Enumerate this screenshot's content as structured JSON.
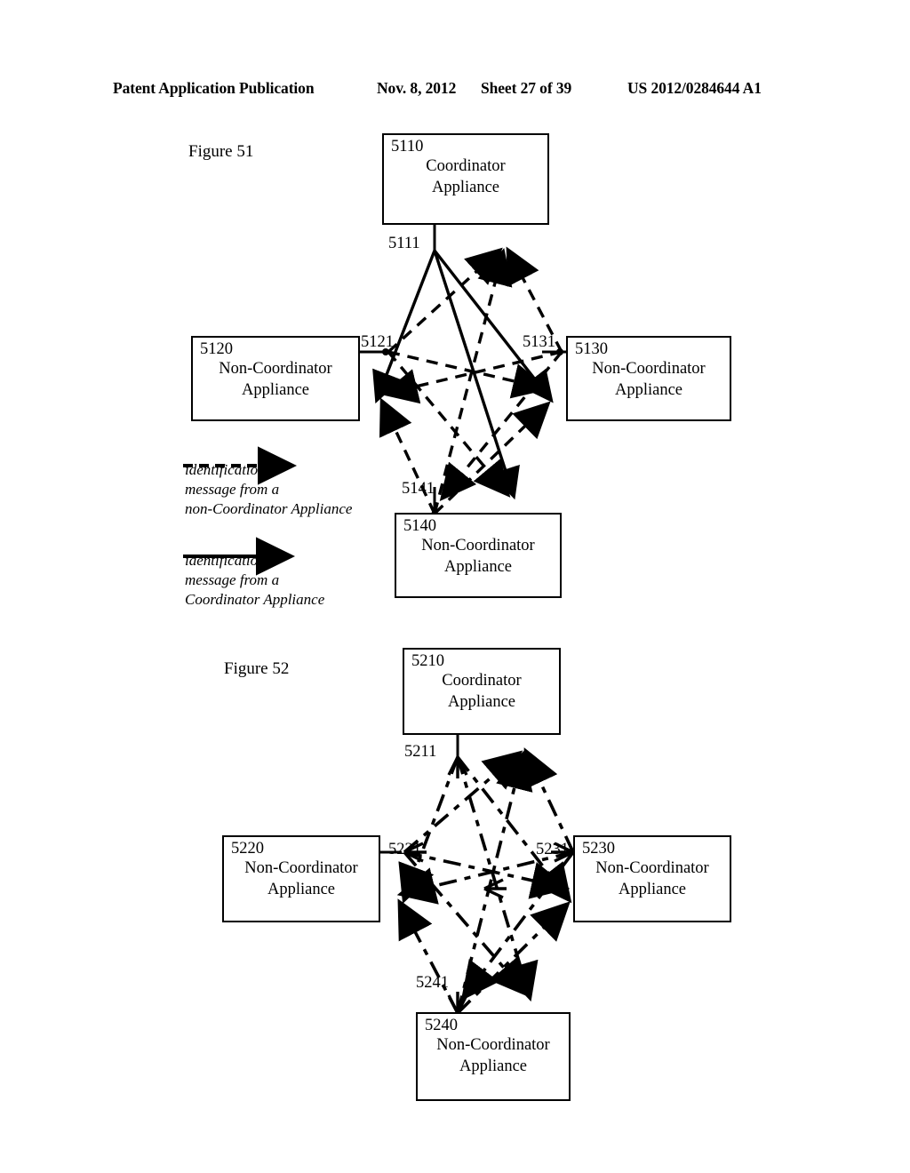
{
  "header": {
    "publication": "Patent Application Publication",
    "date": "Nov. 8, 2012",
    "sheet": "Sheet 27 of 39",
    "number": "US 2012/0284644 A1"
  },
  "figure51": {
    "caption": "Figure 51",
    "boxes": [
      {
        "id": "5110",
        "title_line1": "Coordinator",
        "title_line2": "Appliance"
      },
      {
        "id": "5120",
        "title_line1": "Non-Coordinator",
        "title_line2": "Appliance"
      },
      {
        "id": "5130",
        "title_line1": "Non-Coordinator",
        "title_line2": "Appliance"
      },
      {
        "id": "5140",
        "title_line1": "Non-Coordinator",
        "title_line2": "Appliance"
      }
    ],
    "nodes": [
      {
        "id": "5111"
      },
      {
        "id": "5121"
      },
      {
        "id": "5131"
      },
      {
        "id": "5141"
      }
    ],
    "legend": [
      {
        "line1": "identification",
        "line2": "message from a",
        "line3": "non-Coordinator Appliance",
        "style": "dashed"
      },
      {
        "line1": "identification",
        "line2": "message from a",
        "line3": "Coordinator Appliance",
        "style": "solid"
      }
    ]
  },
  "figure52": {
    "caption": "Figure 52",
    "boxes": [
      {
        "id": "5210",
        "title_line1": "Coordinator",
        "title_line2": "Appliance"
      },
      {
        "id": "5220",
        "title_line1": "Non-Coordinator",
        "title_line2": "Appliance"
      },
      {
        "id": "5230",
        "title_line1": "Non-Coordinator",
        "title_line2": "Appliance"
      },
      {
        "id": "5240",
        "title_line1": "Non-Coordinator",
        "title_line2": "Appliance"
      }
    ],
    "nodes": [
      {
        "id": "5211"
      },
      {
        "id": "5221"
      },
      {
        "id": "5231"
      },
      {
        "id": "5241"
      }
    ]
  },
  "colors": {
    "ink": "#000000",
    "paper": "#ffffff"
  }
}
